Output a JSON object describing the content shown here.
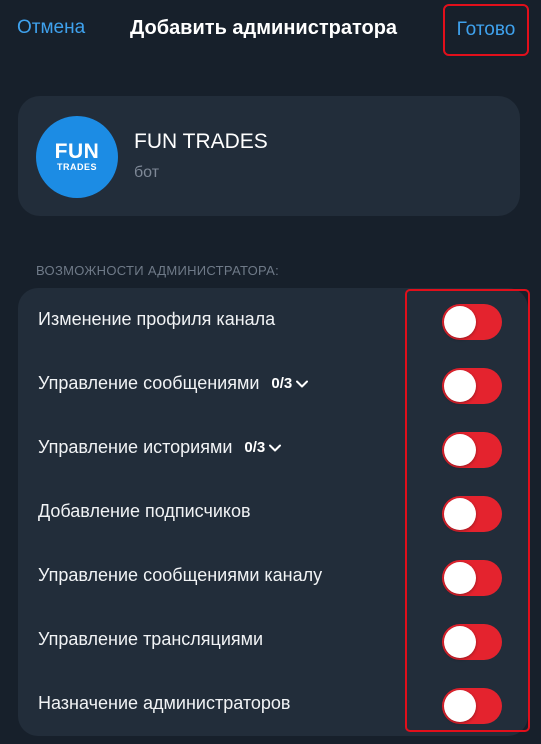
{
  "header": {
    "cancel_label": "Отмена",
    "title": "Добавить администратора",
    "done_label": "Готово"
  },
  "profile": {
    "avatar_line1": "FUN",
    "avatar_line2": "TRADES",
    "name": "FUN TRADES",
    "subtitle": "бот"
  },
  "section_header": "ВОЗМОЖНОСТИ АДМИНИСТРАТОРА:",
  "rights": [
    {
      "label": "Изменение профиля канала",
      "count": "",
      "enabled": false
    },
    {
      "label": "Управление сообщениями",
      "count": "0/3",
      "enabled": false
    },
    {
      "label": "Управление историями",
      "count": "0/3",
      "enabled": false
    },
    {
      "label": "Добавление подписчиков",
      "count": "",
      "enabled": false
    },
    {
      "label": "Управление сообщениями каналу",
      "count": "",
      "enabled": false
    },
    {
      "label": "Управление трансляциями",
      "count": "",
      "enabled": false
    },
    {
      "label": "Назначение администраторов",
      "count": "",
      "enabled": false
    }
  ],
  "colors": {
    "accent": "#3fa2ee",
    "toggle_track": "#e4232e",
    "highlight": "#e10f1b",
    "avatar_bg": "#1c8ce4"
  }
}
